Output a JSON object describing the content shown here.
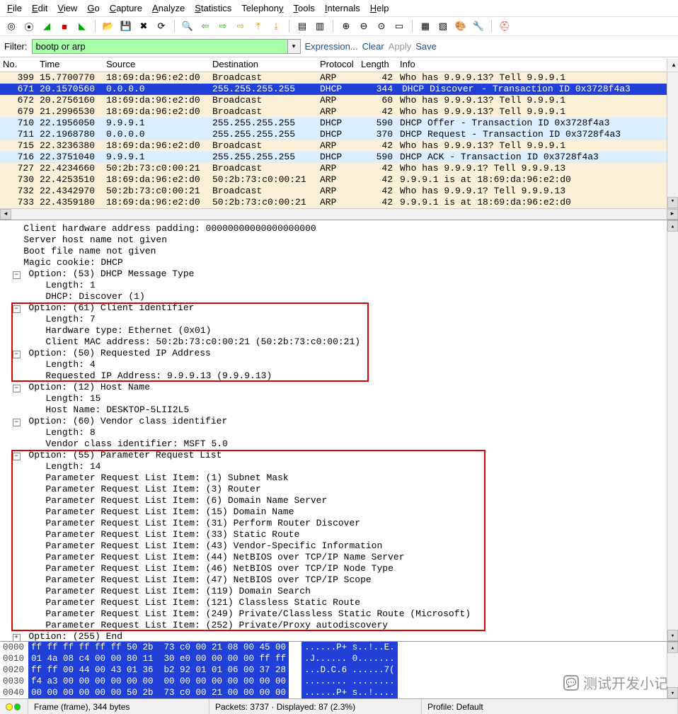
{
  "menu": {
    "file": "File",
    "edit": "Edit",
    "view": "View",
    "go": "Go",
    "capture": "Capture",
    "analyze": "Analyze",
    "statistics": "Statistics",
    "telephony": "Telephony",
    "tools": "Tools",
    "internals": "Internals",
    "help": "Help"
  },
  "filter": {
    "label": "Filter:",
    "value": "bootp or arp",
    "expression": "Expression...",
    "clear": "Clear",
    "apply": "Apply",
    "save": "Save"
  },
  "columns": {
    "no": "No.",
    "time": "Time",
    "source": "Source",
    "destination": "Destination",
    "protocol": "Protocol",
    "length": "Length",
    "info": "Info"
  },
  "packets": [
    {
      "no": "399",
      "time": "15.7700770",
      "src": "18:69:da:96:e2:d0",
      "dst": "Broadcast",
      "proto": "ARP",
      "len": "42",
      "info": "Who has 9.9.9.13?  Tell 9.9.9.1",
      "cls": "arp"
    },
    {
      "no": "671",
      "time": "20.1570560",
      "src": "0.0.0.0",
      "dst": "255.255.255.255",
      "proto": "DHCP",
      "len": "344",
      "info_hl": "DHCP Discover",
      "info_rest": " - Transaction ID 0x3728f4a3",
      "cls": "dhcp",
      "selected": true
    },
    {
      "no": "672",
      "time": "20.2756160",
      "src": "18:69:da:96:e2:d0",
      "dst": "Broadcast",
      "proto": "ARP",
      "len": "60",
      "info": "Who has 9.9.9.13?  Tell 9.9.9.1",
      "cls": "arp"
    },
    {
      "no": "679",
      "time": "21.2996530",
      "src": "18:69:da:96:e2:d0",
      "dst": "Broadcast",
      "proto": "ARP",
      "len": "42",
      "info": "Who has 9.9.9.13?  Tell 9.9.9.1",
      "cls": "arp"
    },
    {
      "no": "710",
      "time": "22.1956050",
      "src": "9.9.9.1",
      "dst": "255.255.255.255",
      "proto": "DHCP",
      "len": "590",
      "info": "DHCP Offer    - Transaction ID 0x3728f4a3",
      "cls": "dhcp"
    },
    {
      "no": "711",
      "time": "22.1968780",
      "src": "0.0.0.0",
      "dst": "255.255.255.255",
      "proto": "DHCP",
      "len": "370",
      "info": "DHCP Request  - Transaction ID 0x3728f4a3",
      "cls": "dhcp"
    },
    {
      "no": "715",
      "time": "22.3236380",
      "src": "18:69:da:96:e2:d0",
      "dst": "Broadcast",
      "proto": "ARP",
      "len": "42",
      "info": "Who has 9.9.9.13?  Tell 9.9.9.1",
      "cls": "arp"
    },
    {
      "no": "716",
      "time": "22.3751040",
      "src": "9.9.9.1",
      "dst": "255.255.255.255",
      "proto": "DHCP",
      "len": "590",
      "info": "DHCP ACK      - Transaction ID 0x3728f4a3",
      "cls": "dhcp"
    },
    {
      "no": "727",
      "time": "22.4234660",
      "src": "50:2b:73:c0:00:21",
      "dst": "Broadcast",
      "proto": "ARP",
      "len": "42",
      "info": "Who has 9.9.9.1?  Tell 9.9.9.13",
      "cls": "arp"
    },
    {
      "no": "730",
      "time": "22.4253510",
      "src": "18:69:da:96:e2:d0",
      "dst": "50:2b:73:c0:00:21",
      "proto": "ARP",
      "len": "42",
      "info": "9.9.9.1 is at 18:69:da:96:e2:d0",
      "cls": "arp"
    },
    {
      "no": "732",
      "time": "22.4342970",
      "src": "50:2b:73:c0:00:21",
      "dst": "Broadcast",
      "proto": "ARP",
      "len": "42",
      "info": "Who has 9.9.9.1?  Tell 9.9.9.13",
      "cls": "arp"
    },
    {
      "no": "733",
      "time": "22.4359180",
      "src": "18:69:da:96:e2:d0",
      "dst": "50:2b:73:c0:00:21",
      "proto": "ARP",
      "len": "42",
      "info": "9.9.9.1 is at 18:69:da:96:e2:d0",
      "cls": "arp"
    }
  ],
  "details": {
    "lines": [
      "    Client hardware address padding: 00000000000000000000",
      "    Server host name not given",
      "    Boot file name not given",
      "    Magic cookie: DHCP",
      "  ⊟ Option: (53) DHCP Message Type",
      "        Length: 1",
      "        DHCP: Discover (1)",
      "  ⊟ Option: (61) Client identifier",
      "        Length: 7",
      "        Hardware type: Ethernet (0x01)",
      "        Client MAC address: 50:2b:73:c0:00:21 (50:2b:73:c0:00:21)",
      "  ⊟ Option: (50) Requested IP Address",
      "        Length: 4",
      "        Requested IP Address: 9.9.9.13 (9.9.9.13)",
      "  ⊟ Option: (12) Host Name",
      "        Length: 15",
      "        Host Name: DESKTOP-5LII2L5",
      "  ⊟ Option: (60) Vendor class identifier",
      "        Length: 8",
      "        Vendor class identifier: MSFT 5.0",
      "  ⊟ Option: (55) Parameter Request List",
      "        Length: 14",
      "        Parameter Request List Item: (1) Subnet Mask",
      "        Parameter Request List Item: (3) Router",
      "        Parameter Request List Item: (6) Domain Name Server",
      "        Parameter Request List Item: (15) Domain Name",
      "        Parameter Request List Item: (31) Perform Router Discover",
      "        Parameter Request List Item: (33) Static Route",
      "        Parameter Request List Item: (43) Vendor-Specific Information",
      "        Parameter Request List Item: (44) NetBIOS over TCP/IP Name Server",
      "        Parameter Request List Item: (46) NetBIOS over TCP/IP Node Type",
      "        Parameter Request List Item: (47) NetBIOS over TCP/IP Scope",
      "        Parameter Request List Item: (119) Domain Search",
      "        Parameter Request List Item: (121) Classless Static Route",
      "        Parameter Request List Item: (249) Private/Classless Static Route (Microsoft)",
      "        Parameter Request List Item: (252) Private/Proxy autodiscovery",
      "  ⊞ Option: (255) End"
    ]
  },
  "hex": [
    {
      "off": "0000",
      "b": "ff ff ff ff ff ff 50 2b  73 c0 00 21 08 00 45 00",
      "a": "......P+ s..!..E."
    },
    {
      "off": "0010",
      "b": "01 4a 08 c4 00 00 80 11  30 e0 00 00 00 00 ff ff",
      "a": ".J...... 0......."
    },
    {
      "off": "0020",
      "b": "ff ff 00 44 00 43 01 36  b2 92 01 01 06 00 37 28",
      "a": "...D.C.6 ......7("
    },
    {
      "off": "0030",
      "b": "f4 a3 00 00 00 00 00 00  00 00 00 00 00 00 00 00",
      "a": "........ ........"
    },
    {
      "off": "0040",
      "b": "00 00 00 00 00 00 50 2b  73 c0 00 21 00 00 00 00",
      "a": "......P+ s..!...."
    }
  ],
  "status": {
    "frame": "Frame (frame), 344 bytes",
    "packets": "Packets: 3737 · Displayed: 87 (2.3%)",
    "profile": "Profile: Default"
  },
  "watermark": "测试开发小记"
}
